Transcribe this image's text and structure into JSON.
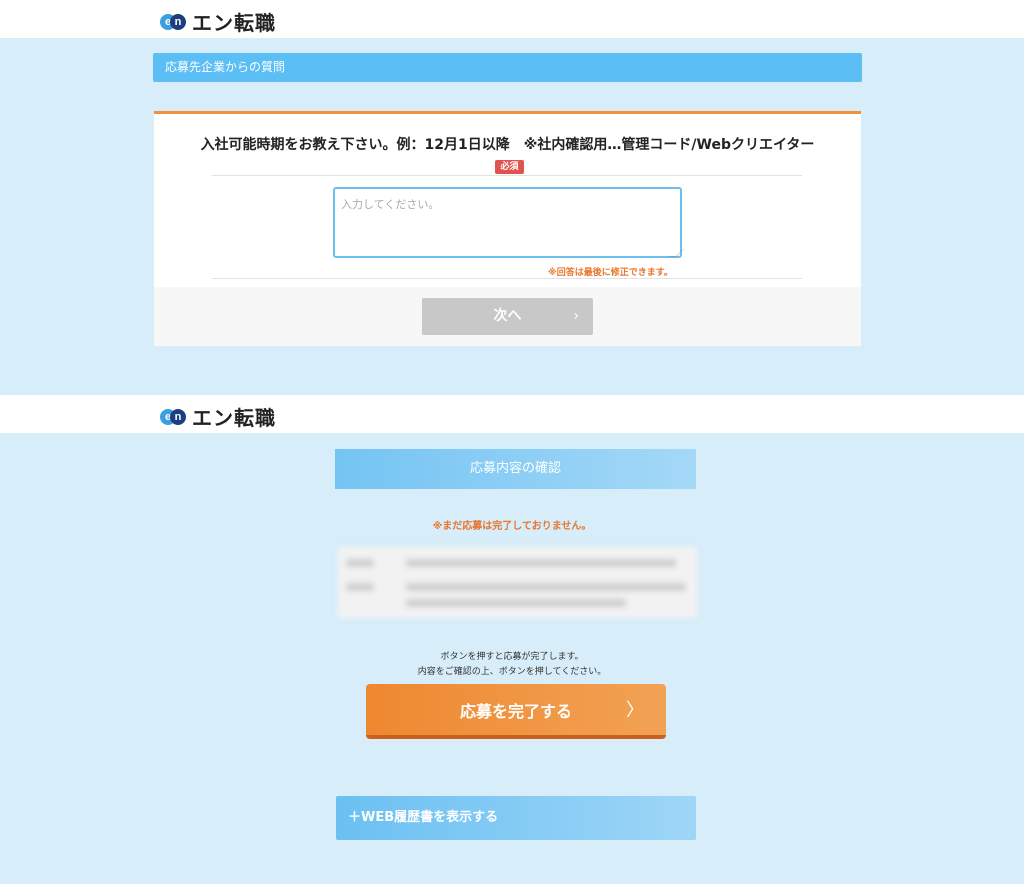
{
  "brand": {
    "logo_e": "e",
    "logo_n": "n",
    "name": "エン転職"
  },
  "question_section": {
    "title": "応募先企業からの質問",
    "question": "入社可能時期をお教え下さい。例：12月1日以降　※社内確認用…管理コード/Webクリエイター",
    "required_badge": "必須",
    "answer_placeholder": "入力してください。",
    "note": "※回答は最後に修正できます。",
    "next_button": "次へ",
    "next_chevron": "›"
  },
  "confirm_section": {
    "title": "応募内容の確認",
    "warning": "※まだ応募は完了しておりません。",
    "instruction_line1": "ボタンを押すと応募が完了します。",
    "instruction_line2": "内容をご確認の上、ボタンを押してください。",
    "complete_button": "応募を完了する",
    "complete_chevron": "〉",
    "resume_button": "＋WEB履歴書を表示する"
  },
  "colors": {
    "background": "#d7edf9",
    "accent_blue": "#5bbef5",
    "accent_orange": "#ee8830",
    "required_red": "#e0534f"
  }
}
